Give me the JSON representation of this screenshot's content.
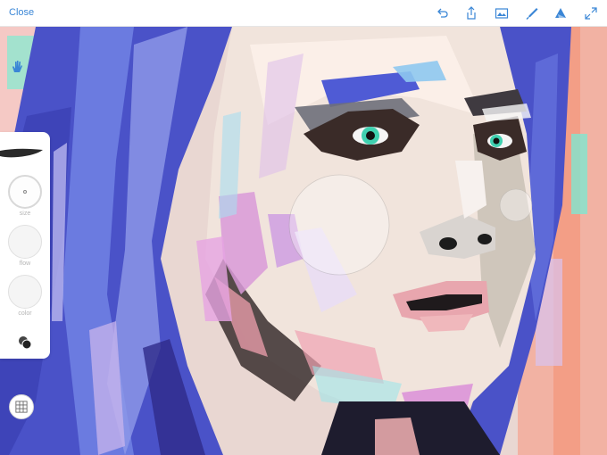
{
  "toolbar": {
    "close_label": "Close",
    "icons": [
      "undo-icon",
      "share-icon",
      "image-icon",
      "brush-icon",
      "layers-icon",
      "expand-icon"
    ],
    "accent_color": "#3a86d6"
  },
  "brush_panel": {
    "size_label": "size",
    "flow_label": "flow",
    "color_label": "color"
  },
  "colors": {
    "hair_blue": "#4a52c8",
    "skin": "#f1e4dc",
    "pink": "#d99ad8",
    "teal": "#5ee0c0",
    "coral": "#f3a08a"
  }
}
